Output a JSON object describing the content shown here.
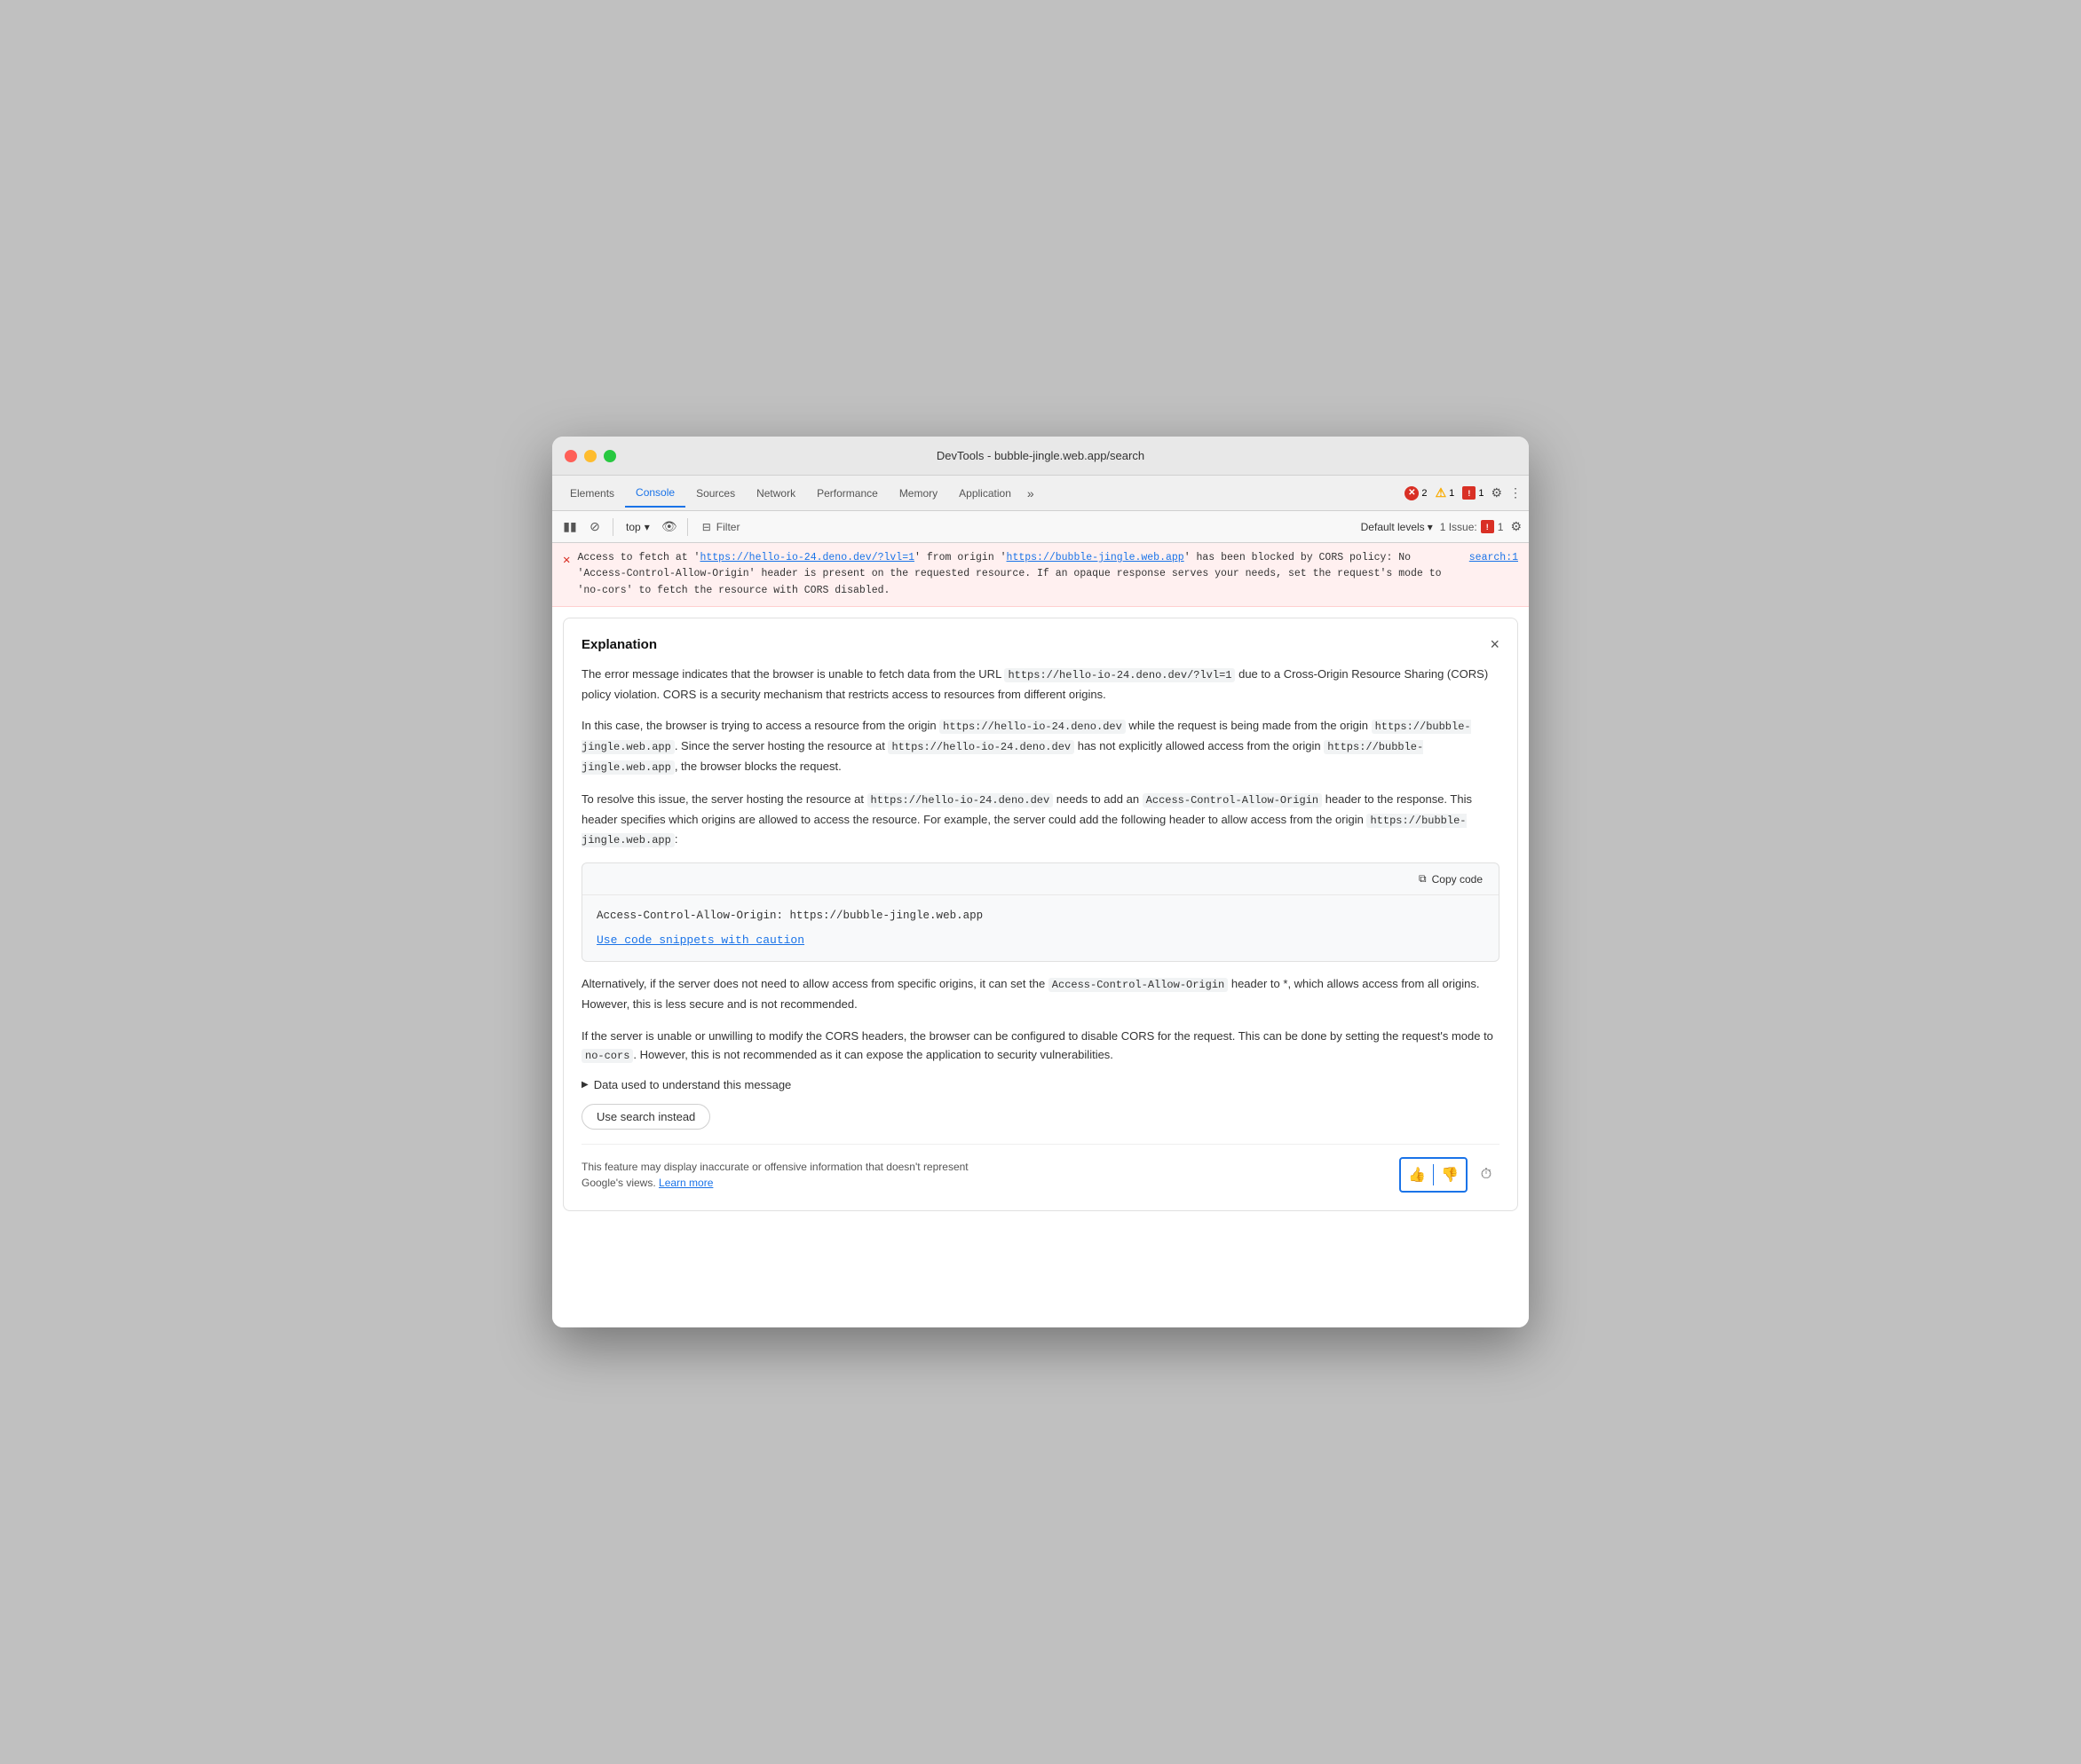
{
  "window": {
    "title": "DevTools - bubble-jingle.web.app/search"
  },
  "tabs": {
    "items": [
      {
        "label": "Elements",
        "active": false
      },
      {
        "label": "Console",
        "active": true
      },
      {
        "label": "Sources",
        "active": false
      },
      {
        "label": "Network",
        "active": false
      },
      {
        "label": "Performance",
        "active": false
      },
      {
        "label": "Memory",
        "active": false
      },
      {
        "label": "Application",
        "active": false
      }
    ],
    "more_label": "»",
    "error_count": "2",
    "warning_count": "1",
    "issue_count": "1"
  },
  "toolbar": {
    "top_label": "top",
    "filter_label": "Filter",
    "default_levels_label": "Default levels",
    "issue_label": "1 Issue:"
  },
  "error_row": {
    "prefix": "Access to fetch at '",
    "url1": "https://hello-io-24.deno.dev/?lvl=1",
    "mid1": "' from origin '",
    "url2": "https://bubble-jingle.web.app",
    "mid2": "' has",
    "rest": "been blocked by CORS policy: No 'Access-Control-Allow-Origin' header is present on the requested resource. If an opaque response serves your needs, set the request's mode to 'no-cors' to fetch the resource with CORS disabled.",
    "source": "search:1"
  },
  "explanation": {
    "title": "Explanation",
    "close_label": "×",
    "paragraphs": {
      "p1": "The error message indicates that the browser is unable to fetch data from the URL https://hello-io-24.deno.dev/?lvl=1 due to a Cross-Origin Resource Sharing (CORS) policy violation. CORS is a security mechanism that restricts access to resources from different origins.",
      "p1_url": "https://hello-io-24.deno.dev/?lvl=1",
      "p2_before": "In this case, the browser is trying to access a resource from the origin ",
      "p2_code1": "https://hello-io-24.deno.dev",
      "p2_mid": " while the request is being made from the origin ",
      "p2_code2": "https://bubble-jingle.web.app",
      "p2_after_before": ". Since the server hosting the resource at ",
      "p2_code3": "https://hello-io-24.deno.dev",
      "p2_after_mid": " has not explicitly allowed access from the origin ",
      "p2_code4": "https://bubble-jingle.web.app",
      "p2_after": ", the browser blocks the request.",
      "p3_before": "To resolve this issue, the server hosting the resource at ",
      "p3_code1": "https://hello-io-24.deno.dev",
      "p3_mid": " needs to add an ",
      "p3_code2": "Access-Control-Allow-Origin",
      "p3_after": " header to the response. This header specifies which origins are allowed to access the resource. For example, the server could add the following header to allow access from the origin ",
      "p3_code3": "https://bubble-jingle.web.app",
      "p3_end": ":"
    },
    "code_block": "Access-Control-Allow-Origin: https://bubble-jingle.web.app",
    "copy_code_label": "Copy code",
    "caution_label": "Use code snippets with caution",
    "p4_before": "Alternatively, if the server does not need to allow access from specific origins, it can set the ",
    "p4_code": "Access-Control-Allow-Origin",
    "p4_after": " header to *, which allows access from all origins. However, this is less secure and is not recommended.",
    "p5_before": "If the server is unable or unwilling to modify the CORS headers, the browser can be configured to disable CORS for the request. This can be done by setting the request's mode to ",
    "p5_code": "no-cors",
    "p5_after": ". However, this is not recommended as it can expose the application to security vulnerabilities.",
    "data_used_label": "Data used to understand this message",
    "use_search_label": "Use search instead",
    "disclaimer": "This feature may display inaccurate or offensive information that doesn't represent Google's views.",
    "learn_more": "Learn more"
  }
}
